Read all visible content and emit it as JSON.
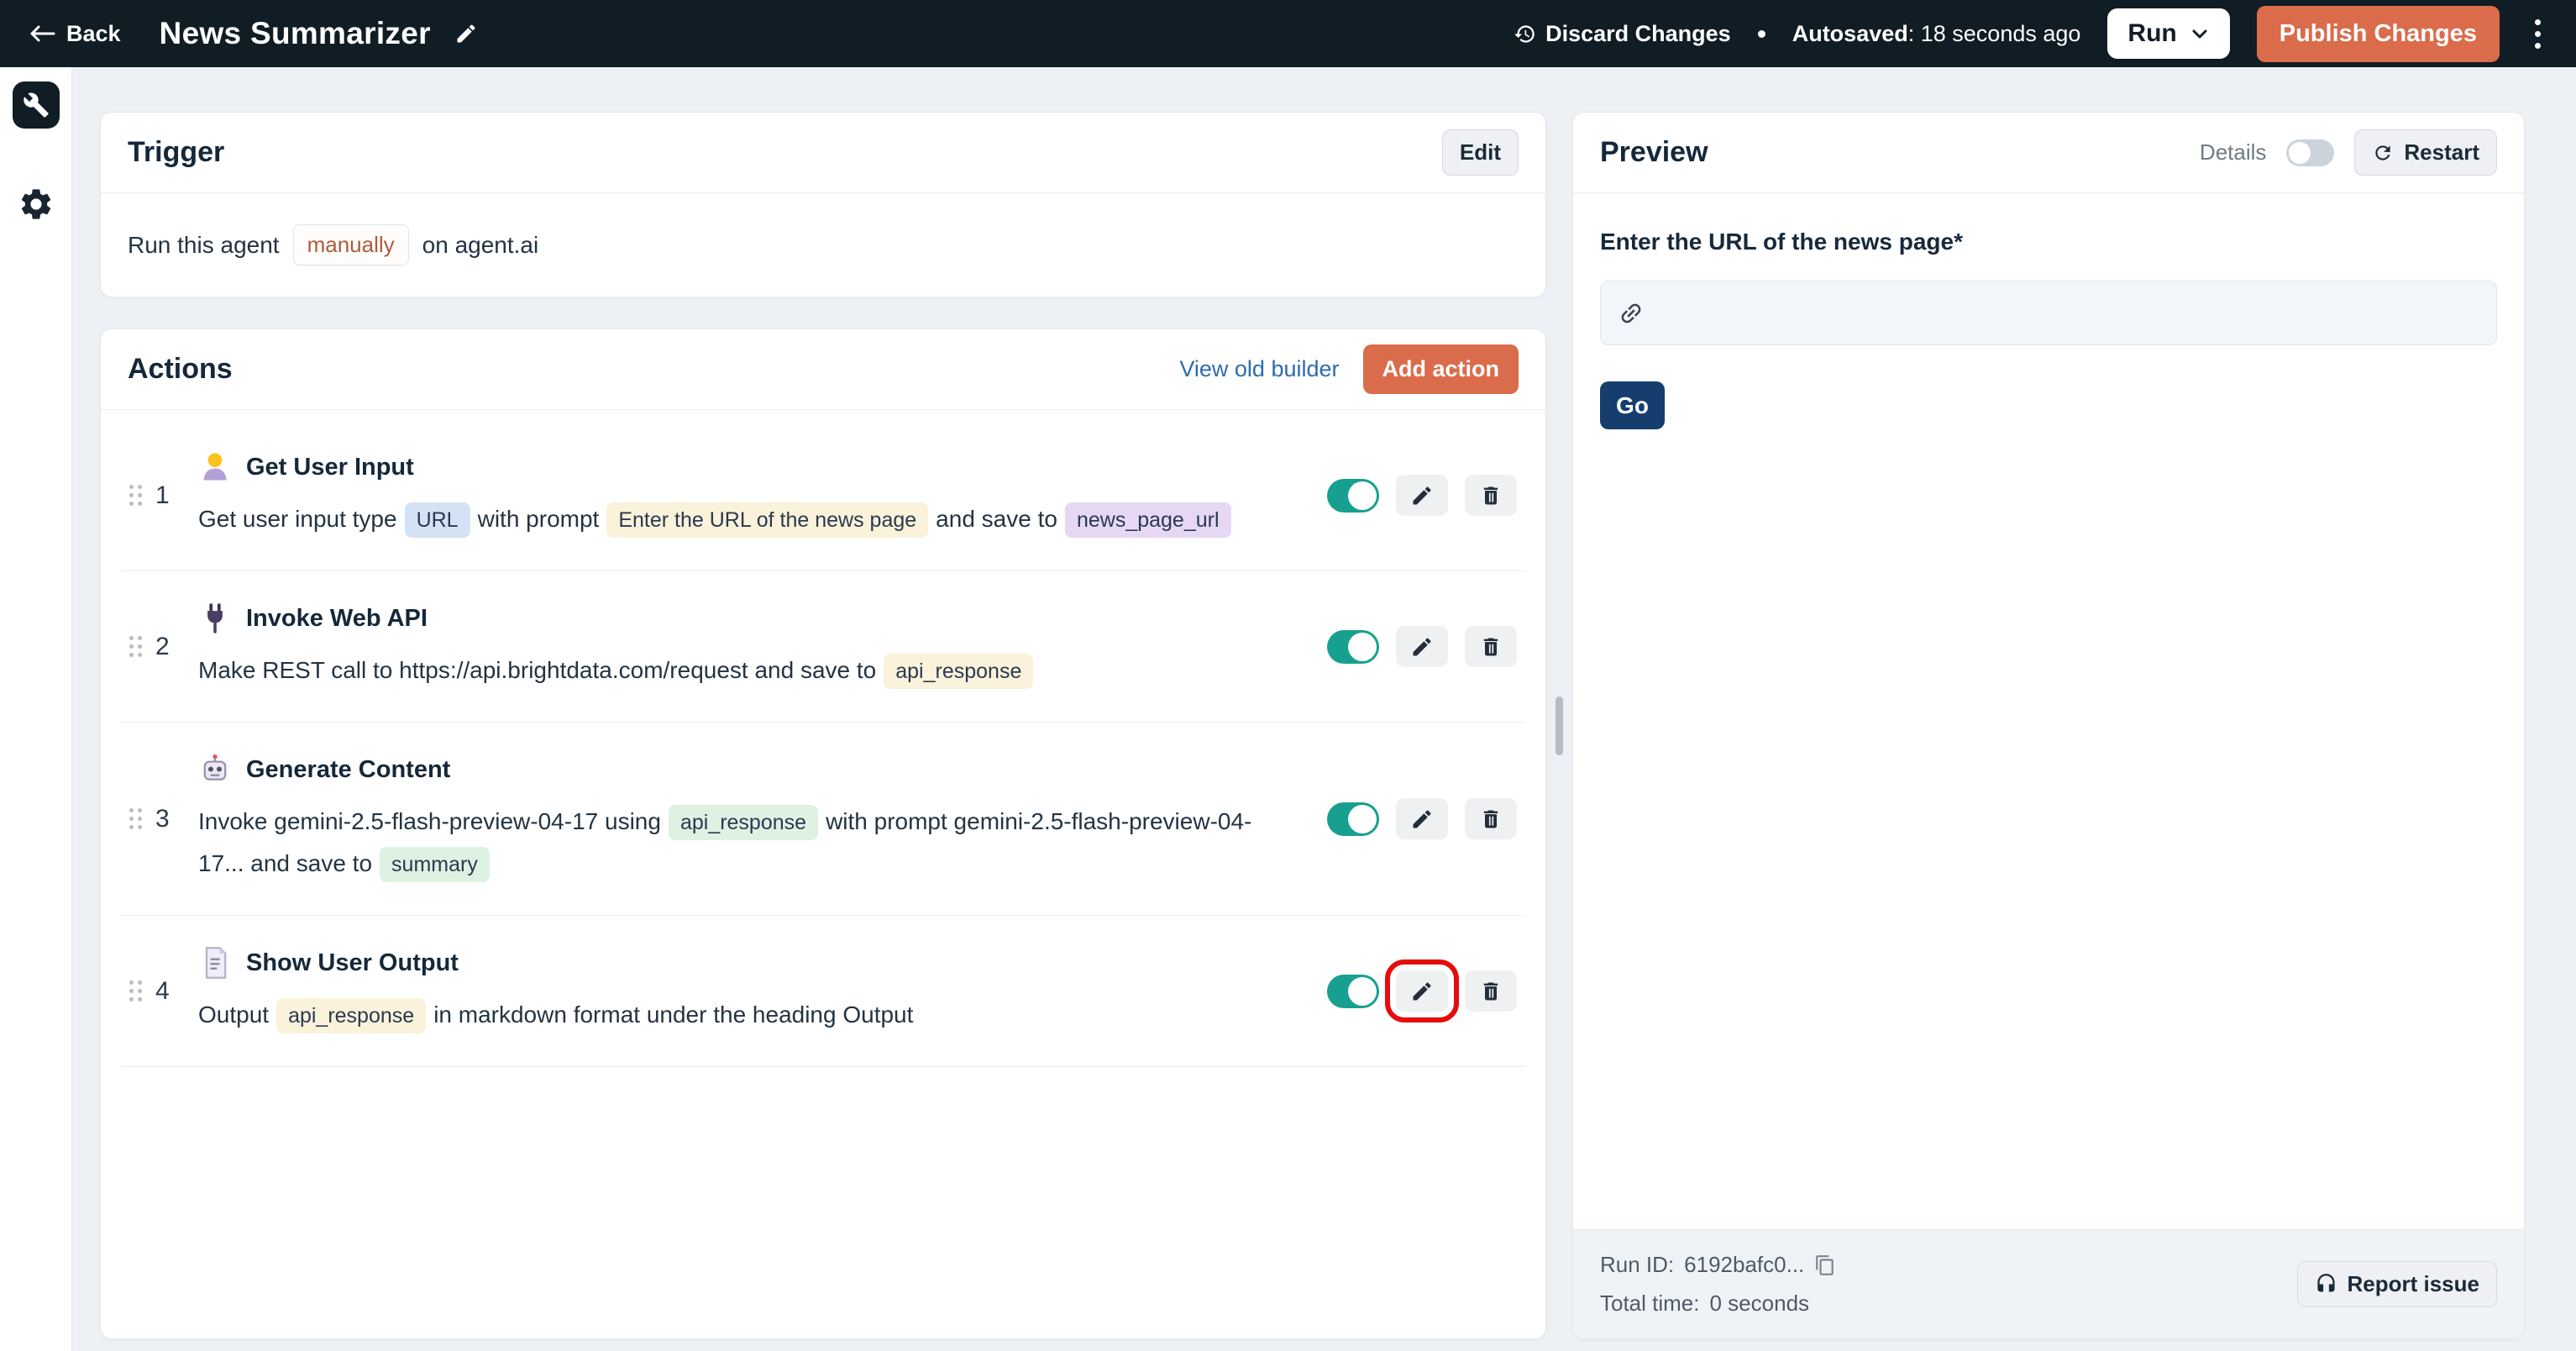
{
  "topbar": {
    "back_label": "Back",
    "title": "News Summarizer",
    "discard_label": "Discard Changes",
    "autosaved_label": "Autosaved",
    "autosaved_suffix": ": 18 seconds ago",
    "run_label": "Run",
    "publish_label": "Publish Changes"
  },
  "sidebar": {
    "items": [
      {
        "icon": "wrench-icon",
        "active": true
      },
      {
        "icon": "gear-icon",
        "active": false
      }
    ]
  },
  "trigger": {
    "title": "Trigger",
    "edit_label": "Edit",
    "sentence_prefix": "Run this agent",
    "mode_chip": "manually",
    "sentence_suffix": "on agent.ai"
  },
  "actions": {
    "title": "Actions",
    "view_old_builder_label": "View old builder",
    "add_action_label": "Add action",
    "rows": [
      {
        "number": "1",
        "icon": "person",
        "title": "Get User Input",
        "enabled": true,
        "highlight_edit": false,
        "segments": [
          {
            "text": "Get user input type"
          },
          {
            "badge": "URL",
            "color": "blue"
          },
          {
            "text": "with prompt"
          },
          {
            "badge": "Enter the URL of the news page",
            "color": "yellow"
          },
          {
            "text": "and save to"
          },
          {
            "badge": "news_page_url",
            "color": "purple"
          }
        ]
      },
      {
        "number": "2",
        "icon": "plug",
        "title": "Invoke Web API",
        "enabled": true,
        "highlight_edit": false,
        "segments": [
          {
            "text": "Make REST call to https://api.brightdata.com/request and save to"
          },
          {
            "badge": "api_response",
            "color": "yellow"
          }
        ]
      },
      {
        "number": "3",
        "icon": "robot",
        "title": "Generate Content",
        "enabled": true,
        "highlight_edit": false,
        "segments": [
          {
            "text": "Invoke gemini-2.5-flash-preview-04-17 using"
          },
          {
            "badge": "api_response",
            "color": "green"
          },
          {
            "text": "with prompt gemini-2.5-flash-preview-04-17... and save to"
          },
          {
            "badge": "summary",
            "color": "green"
          }
        ]
      },
      {
        "number": "4",
        "icon": "document",
        "title": "Show User Output",
        "enabled": true,
        "highlight_edit": true,
        "segments": [
          {
            "text": "Output"
          },
          {
            "badge": "api_response",
            "color": "yellow"
          },
          {
            "text": "in markdown format under the heading Output"
          }
        ]
      }
    ]
  },
  "preview": {
    "title": "Preview",
    "details_label": "Details",
    "details_on": false,
    "restart_label": "Restart",
    "input_label": "Enter the URL of the news page*",
    "input_value": "",
    "go_label": "Go",
    "footer": {
      "run_id_label": "Run ID:",
      "run_id_value": "6192bafc0...",
      "total_time_label": "Total time:",
      "total_time_value": "0 seconds",
      "report_issue_label": "Report issue"
    }
  },
  "colors": {
    "topbar_bg": "#101d24",
    "accent_orange": "#da6c4b",
    "toggle_on_teal": "#17a08f",
    "go_button_navy": "#153e6e",
    "link_blue": "#2e6bb0",
    "highlight_red": "#e60d0d",
    "page_bg": "#edf1f5"
  }
}
